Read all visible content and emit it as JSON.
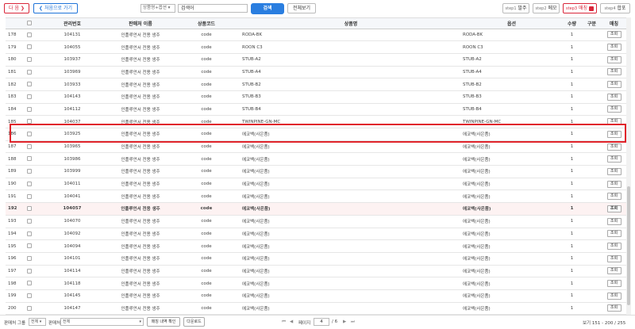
{
  "toolbar": {
    "next_label": "다 음 ❯",
    "first_label": "❮ 처음으로 가기",
    "search_type": "상품명+옵션 ▾",
    "search_value": "검색어",
    "search_label": "검색",
    "show_all_label": "전체보기",
    "step1_small": "step1",
    "step1_label": "발주",
    "step2_small": "step2",
    "step2_label": "메모",
    "step3_small": "step3",
    "step3_label": "매칭",
    "step4_small": "step4",
    "step4_label": "합포"
  },
  "table": {
    "headers": {
      "no": "",
      "check": "",
      "manage_no": "관리번호",
      "seller_name": "판매처 이름",
      "product_code": "상품코드",
      "product_name": "상품명",
      "option": "옵션",
      "qty": "수량",
      "type": "구분",
      "match": "매칭"
    },
    "match_button_label": "조회",
    "rows": [
      {
        "no": "178",
        "id": "104131",
        "seller": "인플루언서 전용 생주",
        "code": "code",
        "name": "RODA-BK",
        "option": "RODA-BK",
        "qty": "1"
      },
      {
        "no": "179",
        "id": "104055",
        "seller": "인플루언서 전용 생주",
        "code": "code",
        "name": "ROON C3",
        "option": "ROON C3",
        "qty": "1"
      },
      {
        "no": "180",
        "id": "103937",
        "seller": "인플루언서 전용 생주",
        "code": "code",
        "name": "STUB-A2",
        "option": "STUB-A2",
        "qty": "1"
      },
      {
        "no": "181",
        "id": "103969",
        "seller": "인플루언서 전용 생주",
        "code": "code",
        "name": "STUB-A4",
        "option": "STUB-A4",
        "qty": "1"
      },
      {
        "no": "182",
        "id": "103933",
        "seller": "인플루언서 전용 생주",
        "code": "code",
        "name": "STUB-B2",
        "option": "STUB-B2",
        "qty": "1"
      },
      {
        "no": "183",
        "id": "104143",
        "seller": "인플루언서 전용 생주",
        "code": "code",
        "name": "STUB-B3",
        "option": "STUB-B3",
        "qty": "1"
      },
      {
        "no": "184",
        "id": "104112",
        "seller": "인플루언서 전용 생주",
        "code": "code",
        "name": "STUB-B4",
        "option": "STUB-B4",
        "qty": "1"
      },
      {
        "no": "185",
        "id": "104037",
        "seller": "인플루언서 전용 생주",
        "code": "code",
        "name": "TWINPINE-GN-MC",
        "option": "TWINPINE-GN-MC",
        "qty": "1"
      },
      {
        "no": "186",
        "id": "103925",
        "seller": "인플루언서 전용 생주",
        "code": "code",
        "name": "에코백(사은품)",
        "option": "에코백(사은품)",
        "qty": "1"
      },
      {
        "no": "187",
        "id": "103965",
        "seller": "인플루언서 전용 생주",
        "code": "code",
        "name": "에코백(사은품)",
        "option": "에코백(사은품)",
        "qty": "1"
      },
      {
        "no": "188",
        "id": "103986",
        "seller": "인플루언서 전용 생주",
        "code": "code",
        "name": "에코백(사은품)",
        "option": "에코백(사은품)",
        "qty": "1"
      },
      {
        "no": "189",
        "id": "103999",
        "seller": "인플루언서 전용 생주",
        "code": "code",
        "name": "에코백(사은품)",
        "option": "에코백(사은품)",
        "qty": "1"
      },
      {
        "no": "190",
        "id": "104011",
        "seller": "인플루언서 전용 생주",
        "code": "code",
        "name": "에코백(사은품)",
        "option": "에코백(사은품)",
        "qty": "1"
      },
      {
        "no": "191",
        "id": "104041",
        "seller": "인플루언서 전용 생주",
        "code": "code",
        "name": "에코백(사은품)",
        "option": "에코백(사은품)",
        "qty": "1"
      },
      {
        "no": "192",
        "id": "104057",
        "seller": "인플루언서 전용 생주",
        "code": "code",
        "name": "에코백(사은품)",
        "option": "에코백(사은품)",
        "qty": "1",
        "selected": true
      },
      {
        "no": "193",
        "id": "104070",
        "seller": "인플루언서 전용 생주",
        "code": "code",
        "name": "에코백(사은품)",
        "option": "에코백(사은품)",
        "qty": "1"
      },
      {
        "no": "194",
        "id": "104092",
        "seller": "인플루언서 전용 생주",
        "code": "code",
        "name": "에코백(사은품)",
        "option": "에코백(사은품)",
        "qty": "1"
      },
      {
        "no": "195",
        "id": "104094",
        "seller": "인플루언서 전용 생주",
        "code": "code",
        "name": "에코백(사은품)",
        "option": "에코백(사은품)",
        "qty": "1"
      },
      {
        "no": "196",
        "id": "104101",
        "seller": "인플루언서 전용 생주",
        "code": "code",
        "name": "에코백(사은품)",
        "option": "에코백(사은품)",
        "qty": "1"
      },
      {
        "no": "197",
        "id": "104114",
        "seller": "인플루언서 전용 생주",
        "code": "code",
        "name": "에코백(사은품)",
        "option": "에코백(사은품)",
        "qty": "1"
      },
      {
        "no": "198",
        "id": "104118",
        "seller": "인플루언서 전용 생주",
        "code": "code",
        "name": "에코백(사은품)",
        "option": "에코백(사은품)",
        "qty": "1"
      },
      {
        "no": "199",
        "id": "104145",
        "seller": "인플루언서 전용 생주",
        "code": "code",
        "name": "에코백(사은품)",
        "option": "에코백(사은품)",
        "qty": "1"
      },
      {
        "no": "200",
        "id": "104147",
        "seller": "인플루언서 전용 생주",
        "code": "code",
        "name": "에코백(사은품)",
        "option": "에코백(사은품)",
        "qty": "1"
      }
    ]
  },
  "footer": {
    "group_label": "판매처 그룹",
    "group_select": "전체 ▾",
    "seller_label": "판매처",
    "seller_select": "전체",
    "match_history_label": "매칭 내역 확인",
    "download_label": "다운로드",
    "first_icon": "⏮",
    "prev_icon": "◀",
    "page_label": "페이지",
    "page_value": "4",
    "page_total": "/ 6",
    "next_icon": "▶",
    "last_icon": "⏭",
    "view_info": "보기 151 - 200 / 255"
  }
}
